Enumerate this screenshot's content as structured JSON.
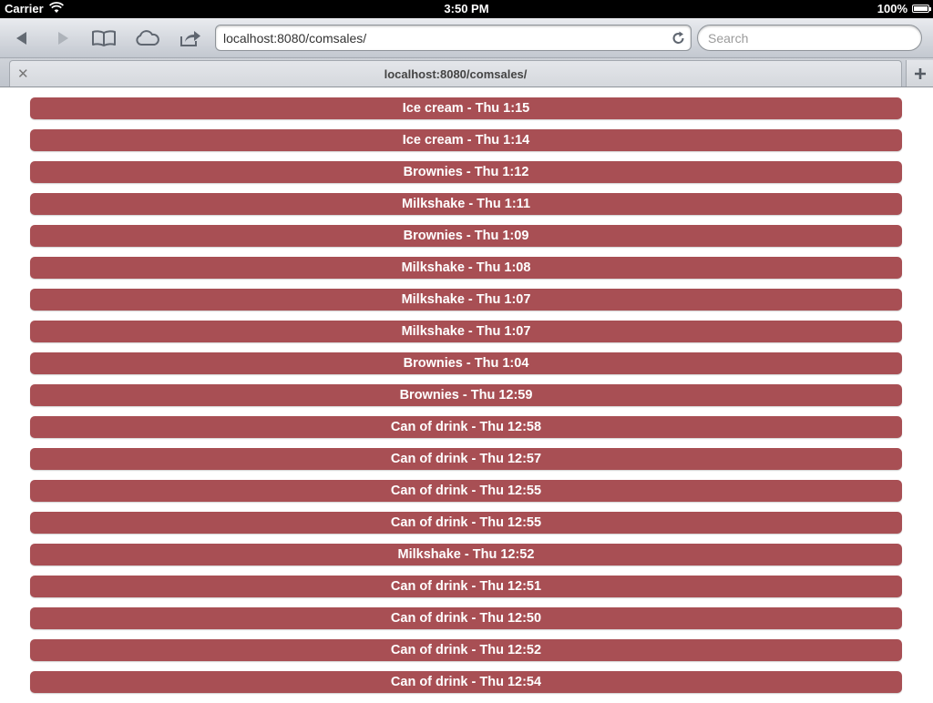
{
  "status_bar": {
    "carrier": "Carrier",
    "time": "3:50 PM",
    "battery": "100%"
  },
  "toolbar": {
    "url": "localhost:8080/comsales/",
    "search_placeholder": "Search",
    "icons": [
      "back-icon",
      "forward-icon",
      "bookmarks-icon",
      "cloud-icon",
      "share-icon",
      "reload-icon"
    ]
  },
  "tab": {
    "title": "localhost:8080/comsales/"
  },
  "sales": [
    {
      "label": "Ice cream - Thu 1:15"
    },
    {
      "label": "Ice cream - Thu 1:14"
    },
    {
      "label": "Brownies - Thu 1:12"
    },
    {
      "label": "Milkshake - Thu 1:11"
    },
    {
      "label": "Brownies - Thu 1:09"
    },
    {
      "label": "Milkshake - Thu 1:08"
    },
    {
      "label": "Milkshake - Thu 1:07"
    },
    {
      "label": "Milkshake - Thu 1:07"
    },
    {
      "label": "Brownies - Thu 1:04"
    },
    {
      "label": "Brownies - Thu 12:59"
    },
    {
      "label": "Can of drink - Thu 12:58"
    },
    {
      "label": "Can of drink - Thu 12:57"
    },
    {
      "label": "Can of drink - Thu 12:55"
    },
    {
      "label": "Can of drink - Thu 12:55"
    },
    {
      "label": "Milkshake - Thu 12:52"
    },
    {
      "label": "Can of drink - Thu 12:51"
    },
    {
      "label": "Can of drink - Thu 12:50"
    },
    {
      "label": "Can of drink - Thu 12:52"
    },
    {
      "label": "Can of drink - Thu 12:54"
    }
  ],
  "colors": {
    "sale_bar": "#a84f54",
    "status_bar": "#000000"
  }
}
